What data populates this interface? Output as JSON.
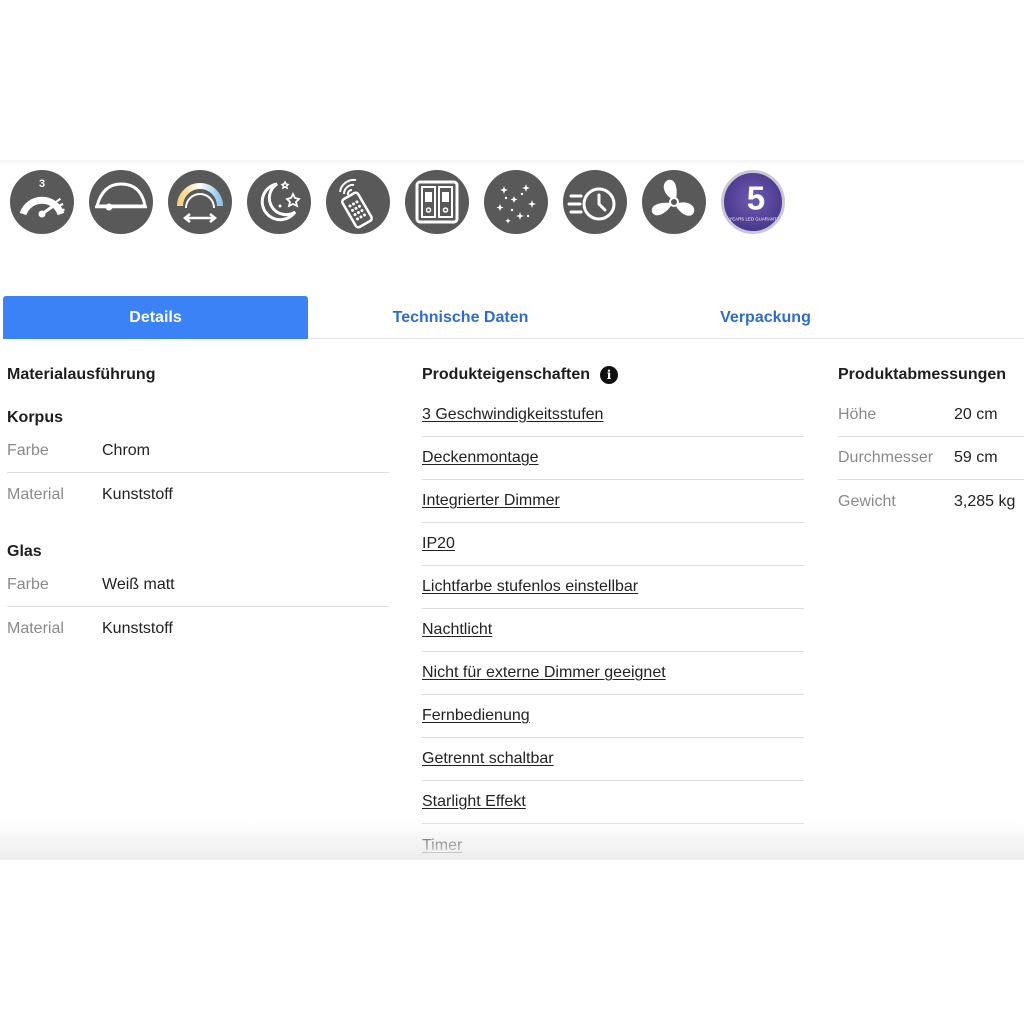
{
  "feature_icons": [
    {
      "icon": "speed-3-icon",
      "text": "3"
    },
    {
      "icon": "ceiling-mount-icon"
    },
    {
      "icon": "light-color-adjust-icon"
    },
    {
      "icon": "night-light-icon"
    },
    {
      "icon": "remote-control-icon"
    },
    {
      "icon": "separate-switch-icon"
    },
    {
      "icon": "starlight-icon"
    },
    {
      "icon": "timer-icon"
    },
    {
      "icon": "fan-icon"
    },
    {
      "icon": "guarantee-badge-icon",
      "number": "5",
      "text": "YEARS LED GUARANTEE"
    }
  ],
  "tabs": [
    {
      "label": "Details",
      "active": true
    },
    {
      "label": "Technische Daten",
      "active": false
    },
    {
      "label": "Verpackung",
      "active": false
    }
  ],
  "details": {
    "material": {
      "title": "Materialausführung",
      "groups": [
        {
          "name": "Korpus",
          "rows": [
            {
              "key": "Farbe",
              "value": "Chrom"
            },
            {
              "key": "Material",
              "value": "Kunststoff"
            }
          ]
        },
        {
          "name": "Glas",
          "rows": [
            {
              "key": "Farbe",
              "value": "Weiß matt"
            },
            {
              "key": "Material",
              "value": "Kunststoff"
            }
          ]
        }
      ]
    },
    "properties": {
      "title": "Produkteigenschaften",
      "info_icon": "i",
      "items": [
        "3 Geschwindigkeitsstufen",
        "Deckenmontage",
        "Integrierter Dimmer",
        "IP20",
        "Lichtfarbe stufenlos einstellbar",
        "Nachtlicht",
        "Nicht für externe Dimmer geeignet",
        "Fernbedienung",
        "Getrennt schaltbar",
        "Starlight Effekt",
        "Timer"
      ]
    },
    "dimensions": {
      "title": "Produktabmessungen",
      "rows": [
        {
          "key": "Höhe",
          "value": "20 cm"
        },
        {
          "key": "Durchmesser",
          "value": "59 cm"
        },
        {
          "key": "Gewicht",
          "value": "3,285 kg"
        }
      ]
    }
  },
  "colors": {
    "accent": "#3b82f6",
    "tab_text": "#2f6dcc",
    "icon_bg": "#595959",
    "badge_bg": "#4b3a8e"
  }
}
